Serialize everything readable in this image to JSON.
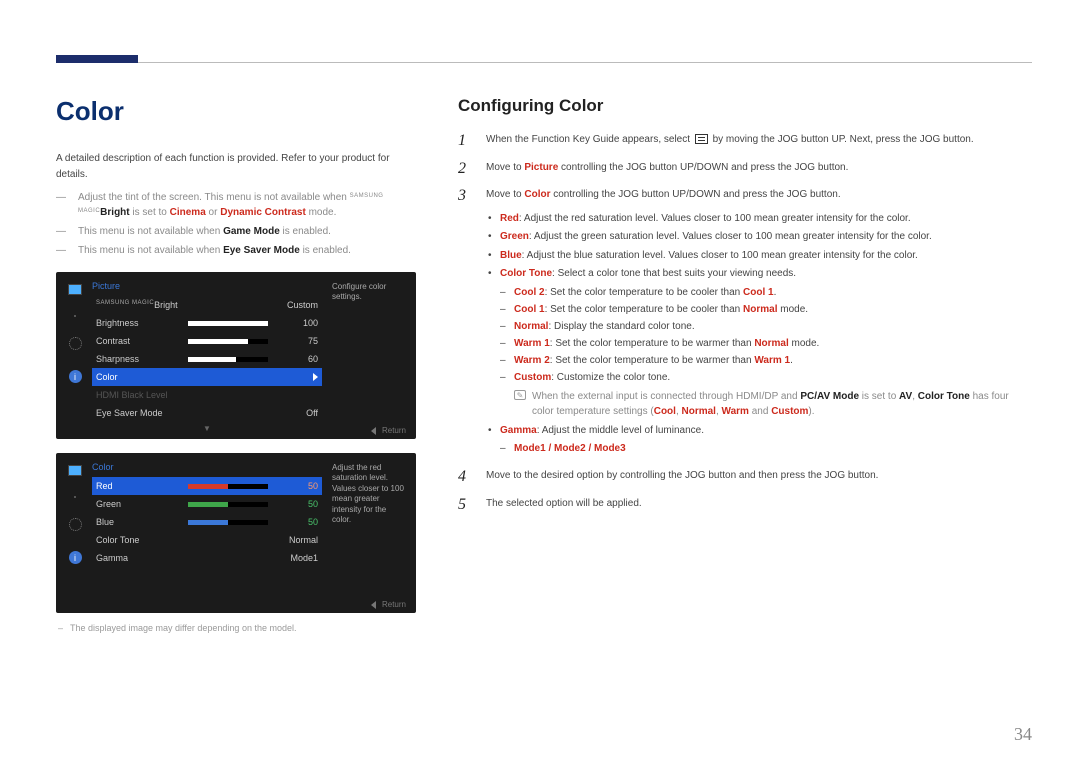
{
  "pageNumber": "34",
  "left": {
    "title": "Color",
    "intro": "A detailed description of each function is provided. Refer to your product for details.",
    "notes": {
      "n1_pre": "Adjust the tint of the screen. This menu is not available when ",
      "n1_magic_small": "SAMSUNG MAGIC",
      "n1_bright": "Bright",
      "n1_mid": " is set to ",
      "n1_cinema": "Cinema",
      "n1_or": " or ",
      "n1_dc": "Dynamic Contrast",
      "n1_end": " mode.",
      "n2_pre": "This menu is not available when ",
      "n2_gm": "Game Mode",
      "n2_end": " is enabled.",
      "n3_pre": "This menu is not available when ",
      "n3_es": "Eye Saver Mode",
      "n3_end": " is enabled."
    },
    "osd1": {
      "header": "Picture",
      "tip": "Configure color settings.",
      "magic_small": "SAMSUNG MAGIC",
      "magic_label": "Bright",
      "magic_val": "Custom",
      "brightness": "Brightness",
      "brightness_val": "100",
      "contrast": "Contrast",
      "contrast_val": "75",
      "sharpness": "Sharpness",
      "sharpness_val": "60",
      "color": "Color",
      "hdmi": "HDMI Black Level",
      "eye": "Eye Saver Mode",
      "eye_val": "Off",
      "return": "Return"
    },
    "osd2": {
      "header": "Color",
      "tip": "Adjust the red saturation level. Values closer to 100 mean greater intensity for the color.",
      "red": "Red",
      "red_val": "50",
      "green": "Green",
      "green_val": "50",
      "blue": "Blue",
      "blue_val": "50",
      "colortone": "Color Tone",
      "colortone_val": "Normal",
      "gamma": "Gamma",
      "gamma_val": "Mode1",
      "return": "Return"
    },
    "footnote": "The displayed image may differ depending on the model."
  },
  "right": {
    "title": "Configuring Color",
    "step1_a": "When the Function Key Guide appears, select ",
    "step1_b": " by moving the JOG button UP. Next, press the JOG button.",
    "step2_a": "Move to ",
    "step2_pic": "Picture",
    "step2_b": " controlling the JOG button UP/DOWN and press the JOG button.",
    "step3_a": "Move to ",
    "step3_col": "Color",
    "step3_b": " controlling the JOG button UP/DOWN and press the JOG button.",
    "red_label": "Red",
    "red_desc": ": Adjust the red saturation level. Values closer to 100 mean greater intensity for the color.",
    "green_label": "Green",
    "green_desc": ": Adjust the green saturation level. Values closer to 100 mean greater intensity for the color.",
    "blue_label": "Blue",
    "blue_desc": ": Adjust the blue saturation level. Values closer to 100 mean greater intensity for the color.",
    "ct_label": "Color Tone",
    "ct_desc": ": Select a color tone that best suits your viewing needs.",
    "cool2_l": "Cool 2",
    "cool2_a": ": Set the color temperature to be cooler than ",
    "cool2_b": "Cool 1",
    "cool2_c": ".",
    "cool1_l": "Cool 1",
    "cool1_a": ": Set the color temperature to be cooler than ",
    "cool1_b": "Normal",
    "cool1_c": " mode.",
    "normal_l": "Normal",
    "normal_a": ": Display the standard color tone.",
    "warm1_l": "Warm 1",
    "warm1_a": ": Set the color temperature to be warmer than ",
    "warm1_b": "Normal",
    "warm1_c": " mode.",
    "warm2_l": "Warm 2",
    "warm2_a": ": Set the color temperature to be warmer than ",
    "warm2_b": "Warm 1",
    "warm2_c": ".",
    "custom_l": "Custom",
    "custom_a": ": Customize the color tone.",
    "info_a": "When the external input is connected through HDMI/DP and ",
    "info_pc": "PC/AV Mode",
    "info_b": " is set to ",
    "info_av": "AV",
    "info_c": ", ",
    "info_ct": "Color Tone",
    "info_d": " has four color temperature settings (",
    "info_cool": "Cool",
    "info_s1": ", ",
    "info_norm": "Normal",
    "info_s2": ", ",
    "info_warm": "Warm",
    "info_s3": " and ",
    "info_cust": "Custom",
    "info_e": ").",
    "gamma_l": "Gamma",
    "gamma_a": ": Adjust the middle level of luminance.",
    "modes": "Mode1 / Mode2 / Mode3",
    "step4": "Move to the desired option by controlling the JOG button and then press the JOG button.",
    "step5": "The selected option will be applied."
  }
}
